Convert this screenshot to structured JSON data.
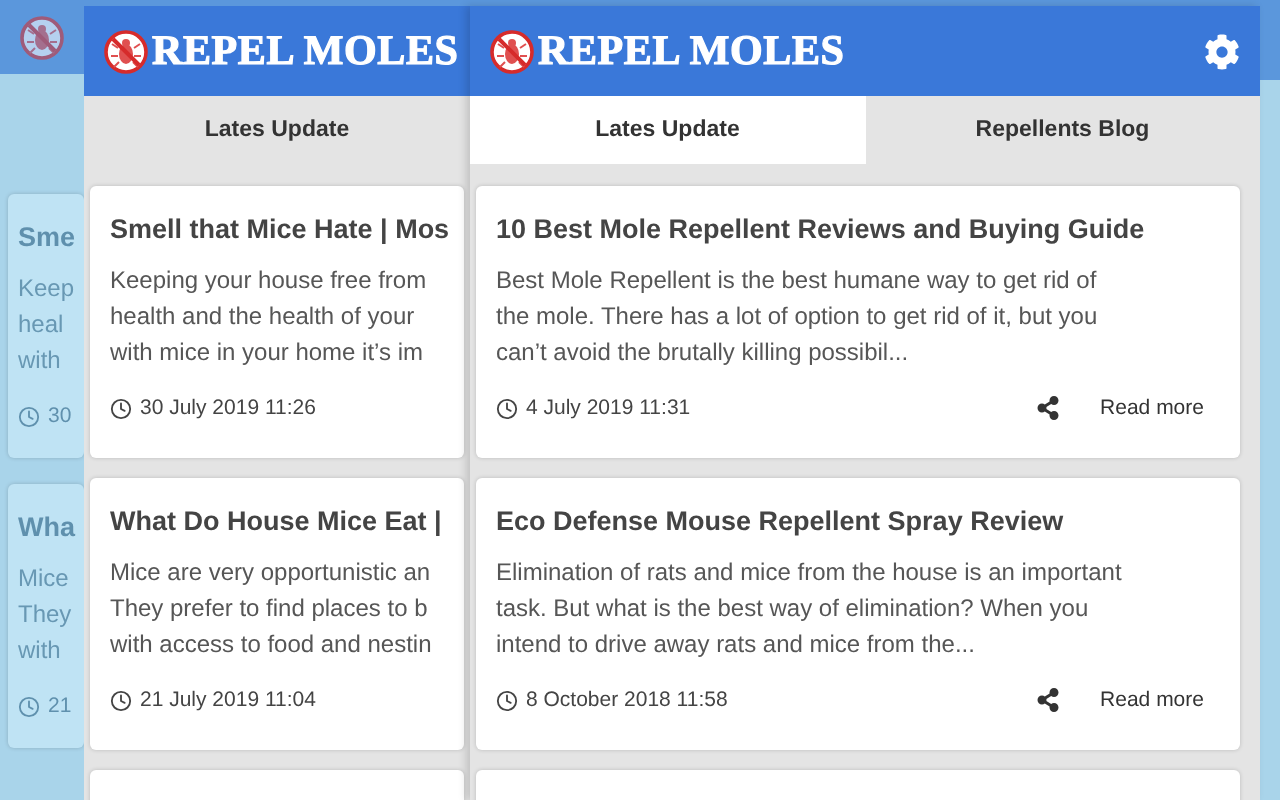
{
  "layers": [
    {
      "kind": "back",
      "settings": false,
      "cards": [
        {
          "title": "Sme",
          "excerpt_lines": [
            "Keep",
            "heal",
            "with"
          ],
          "date": "30",
          "share": false
        },
        {
          "title": "Wha",
          "excerpt_lines": [
            "Mice",
            "They",
            "with"
          ],
          "date": "21",
          "share": false
        }
      ]
    },
    {
      "kind": "middle",
      "brand": "REPEL MOLES",
      "settings": false,
      "tabs": [
        {
          "label": "Lates Update",
          "selected": false
        }
      ],
      "cards": [
        {
          "title": "Smell that Mice Hate | Mos",
          "excerpt_lines": [
            "Keeping your house free from",
            "health and the health of your",
            "with mice in your home it’s im"
          ],
          "date": "30 July 2019 11:26",
          "share": false
        },
        {
          "title": "What Do House Mice Eat |",
          "excerpt_lines": [
            "Mice are very opportunistic an",
            "They prefer to find places to b",
            "with access to food and nestin"
          ],
          "date": "21 July 2019 11:04",
          "share": false
        }
      ]
    },
    {
      "kind": "front",
      "brand": "REPEL MOLES",
      "settings": true,
      "tabs": [
        {
          "label": "Lates Update",
          "selected": true
        },
        {
          "label": "Repellents Blog",
          "selected": false
        }
      ],
      "cards": [
        {
          "title": "10 Best Mole Repellent Reviews and Buying Guide",
          "excerpt_lines": [
            "Best Mole Repellent is the best humane way to get rid of",
            "the mole. There has a lot of option to get rid of it, but you",
            "can’t avoid the brutally killing possibil..."
          ],
          "date": "4 July 2019 11:31",
          "share": true,
          "read_more": "Read more"
        },
        {
          "title": "Eco Defense Mouse Repellent Spray Review",
          "excerpt_lines": [
            "Elimination of rats and mice from the house is an important",
            "task. But what is the best way of elimination? When you",
            "intend to drive away rats and mice from the..."
          ],
          "date": "8 October 2018 11:58",
          "share": true,
          "read_more": "Read more"
        }
      ]
    }
  ]
}
